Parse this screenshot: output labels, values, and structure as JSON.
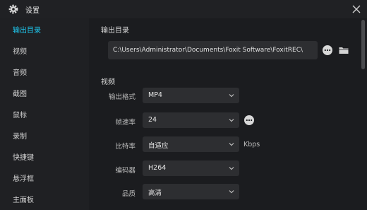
{
  "window": {
    "title": "设置"
  },
  "sidebar": {
    "items": [
      {
        "label": "输出目录",
        "active": true
      },
      {
        "label": "视频"
      },
      {
        "label": "音频"
      },
      {
        "label": "截图"
      },
      {
        "label": "鼠标"
      },
      {
        "label": "录制"
      },
      {
        "label": "快捷键"
      },
      {
        "label": "悬浮框"
      },
      {
        "label": "主面板"
      }
    ]
  },
  "output": {
    "section_title": "输出目录",
    "path": "C:\\Users\\Administrator\\Documents\\Foxit Software\\FoxitREC\\"
  },
  "video": {
    "section_title": "视频",
    "fields": [
      {
        "label": "输出格式",
        "value": "MP4"
      },
      {
        "label": "帧速率",
        "value": "24"
      },
      {
        "label": "比特率",
        "value": "自适应",
        "unit": "Kbps"
      },
      {
        "label": "编码器",
        "value": "H264"
      },
      {
        "label": "品质",
        "value": "高清"
      }
    ]
  },
  "colors": {
    "accent": "#1fc8ef",
    "background": "#1b1c1f",
    "input": "#2d2e31"
  }
}
